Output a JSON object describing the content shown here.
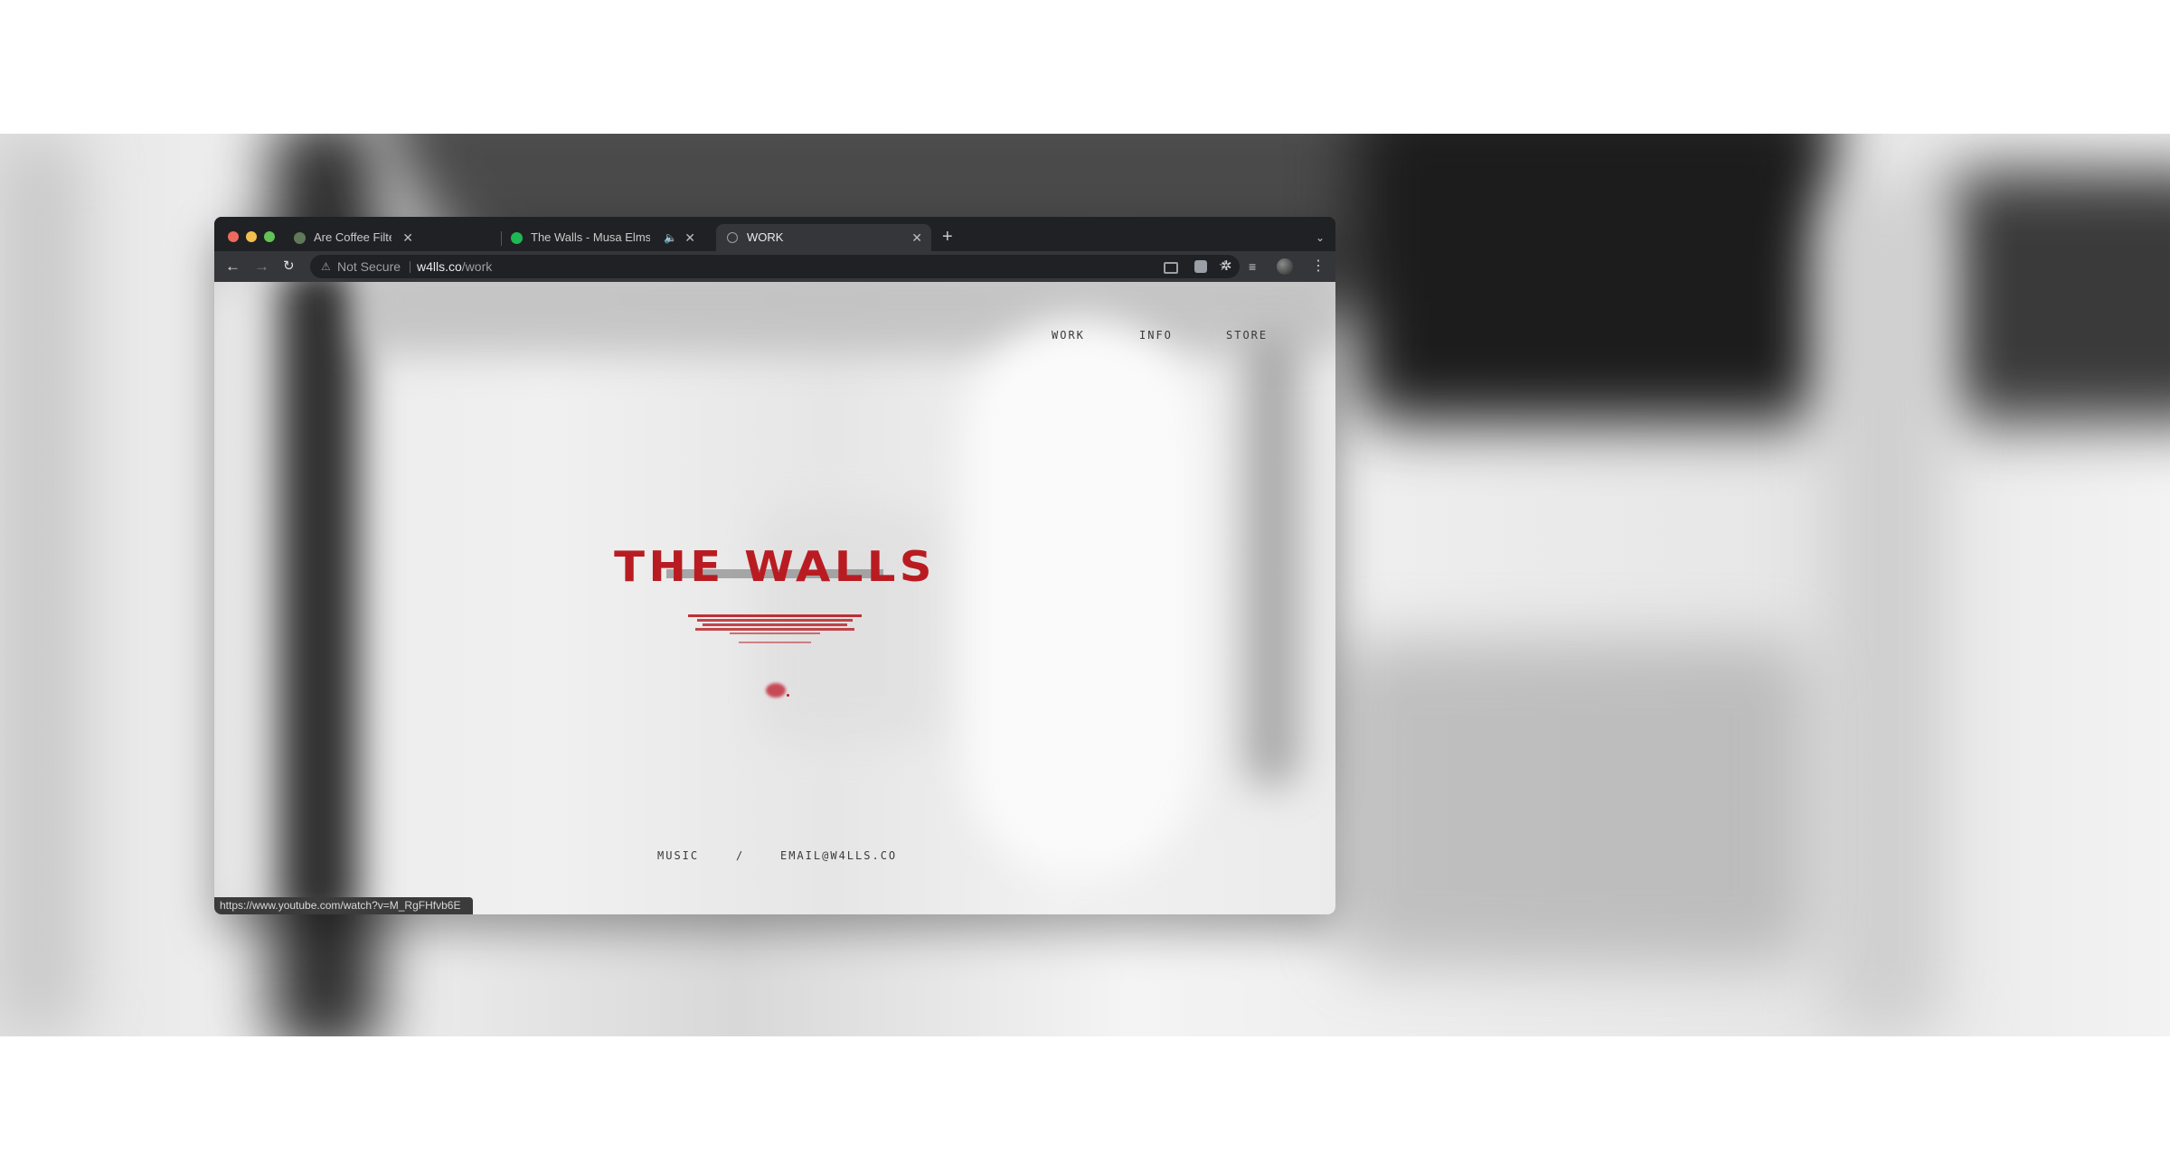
{
  "browser": {
    "tabs": [
      {
        "title": "Are Coffee Filter Safe – An Hon",
        "favicon": "site-favicon",
        "active": false
      },
      {
        "title": "The Walls - Musa Elms",
        "favicon": "spotify-favicon",
        "audio": true,
        "active": false
      },
      {
        "title": "WORK",
        "favicon": "globe-favicon",
        "active": true
      }
    ],
    "address": {
      "security_label": "Not Secure",
      "url_host": "w4lls.co",
      "url_path": "/work"
    },
    "status_url": "https://www.youtube.com/watch?v=M_RgFHfvb6E"
  },
  "site": {
    "nav": [
      "WORK",
      "INFO",
      "STORE"
    ],
    "title": "THE WALLS",
    "footer": {
      "music": "MUSIC",
      "separator": "/",
      "email": "EMAIL@W4LLS.CO"
    }
  },
  "colors": {
    "accent": "#b81c22",
    "chrome_dark": "#202124",
    "chrome_toolbar": "#35363a"
  }
}
